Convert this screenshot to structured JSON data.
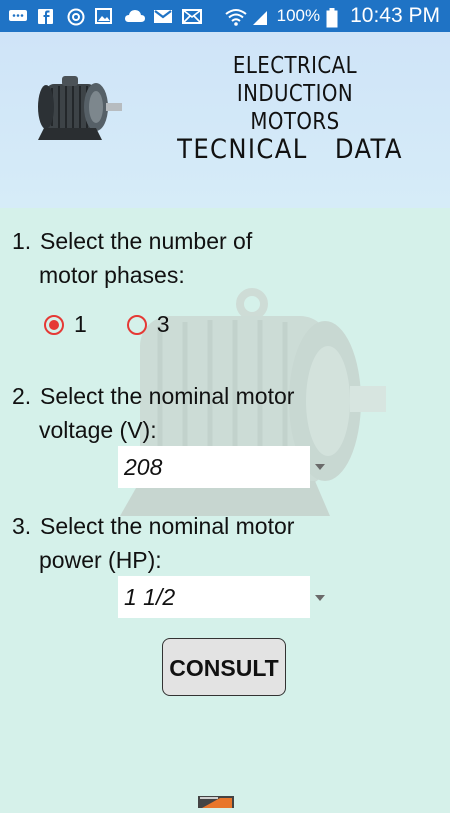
{
  "status_bar": {
    "battery_percent": "100%",
    "time": "10:43 PM",
    "icons": [
      "chat-icon",
      "facebook-icon",
      "sync-icon",
      "image-icon",
      "cloud-icon",
      "gmail-icon",
      "mail-icon",
      "wifi-icon",
      "signal-icon",
      "battery-icon"
    ]
  },
  "header": {
    "title_line1": "ELECTRICAL INDUCTION",
    "title_line2": "MOTORS",
    "subtitle": "TECNICAL   DATA"
  },
  "form": {
    "q1": {
      "number": "1.",
      "line1": "Select the number of",
      "line2": "motor phases:"
    },
    "phase_options": [
      {
        "label": "1",
        "checked": true
      },
      {
        "label": "3",
        "checked": false
      }
    ],
    "q2": {
      "number": "2.",
      "line1": "Select the nominal motor",
      "line2": "voltage (V):"
    },
    "voltage_selected": "208",
    "q3": {
      "number": "3.",
      "line1": "Select the nominal motor",
      "line2": "power (HP):"
    },
    "power_selected": "1 1/2",
    "consult_label": "CONSULT"
  },
  "colors": {
    "status_bar": "#1f73c5",
    "header_bg": "#cfe4f8",
    "content_bg": "#d5f1ea",
    "radio_accent": "#e53935"
  }
}
